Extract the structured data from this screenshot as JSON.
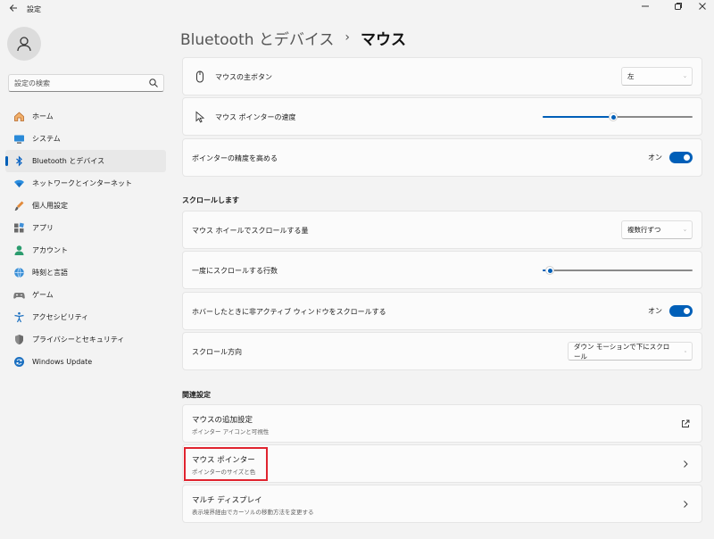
{
  "window": {
    "title": "設定"
  },
  "sidebar": {
    "search_placeholder": "設定の検索",
    "items": [
      {
        "label": "ホーム",
        "icon": "home-icon",
        "active": false
      },
      {
        "label": "システム",
        "icon": "system-icon",
        "active": false
      },
      {
        "label": "Bluetooth とデバイス",
        "icon": "bluetooth-icon",
        "active": true
      },
      {
        "label": "ネットワークとインターネット",
        "icon": "network-icon",
        "active": false
      },
      {
        "label": "個人用設定",
        "icon": "personalization-icon",
        "active": false
      },
      {
        "label": "アプリ",
        "icon": "apps-icon",
        "active": false
      },
      {
        "label": "アカウント",
        "icon": "account-icon",
        "active": false
      },
      {
        "label": "時刻と言語",
        "icon": "time-language-icon",
        "active": false
      },
      {
        "label": "ゲーム",
        "icon": "gaming-icon",
        "active": false
      },
      {
        "label": "アクセシビリティ",
        "icon": "accessibility-icon",
        "active": false
      },
      {
        "label": "プライバシーとセキュリティ",
        "icon": "privacy-shield-icon",
        "active": false
      },
      {
        "label": "Windows Update",
        "icon": "windows-update-icon",
        "active": false
      }
    ]
  },
  "breadcrumb": {
    "parent": "Bluetooth とデバイス",
    "separator": "›",
    "current": "マウス"
  },
  "settings": {
    "primary_button": {
      "label": "マウスの主ボタン",
      "value": "左"
    },
    "pointer_speed": {
      "label": "マウス ポインターの速度",
      "level": 0.47
    },
    "precision": {
      "label": "ポインターの精度を高める",
      "state": "オン"
    }
  },
  "scroll_section": {
    "heading": "スクロールします",
    "wheel_amount": {
      "label": "マウス ホイールでスクロールする量",
      "value": "複数行ずつ"
    },
    "lines": {
      "label": "一度にスクロールする行数",
      "level": 0.05
    },
    "inactive_scroll": {
      "label": "ホバーしたときに非アクティブ ウィンドウをスクロールする",
      "state": "オン"
    },
    "direction": {
      "label": "スクロール方向",
      "value": "ダウン モーションで下にスクロール"
    }
  },
  "related": {
    "heading": "関連設定",
    "additional": {
      "title": "マウスの追加設定",
      "subtitle": "ポインター アイコンと可視性"
    },
    "pointer": {
      "title": "マウス ポインター",
      "subtitle": "ポインターのサイズと色"
    },
    "multi_display": {
      "title": "マルチ ディスプレイ",
      "subtitle": "表示境界経由でカーソルの移動方法を変更する"
    }
  },
  "colors": {
    "accent": "#005fb8",
    "highlight": "#e0242f"
  }
}
